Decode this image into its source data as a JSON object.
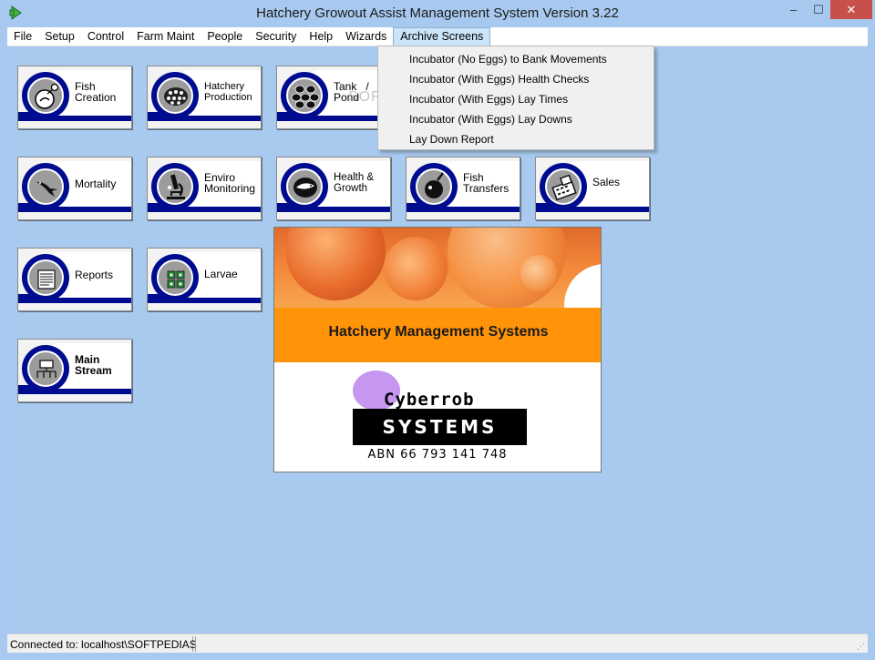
{
  "window": {
    "title": "Hatchery Growout Assist Management System Version 3.22",
    "icon": "green-arrow-icon",
    "controls": {
      "minimize": "–",
      "maximize": "☐",
      "close": "✕"
    }
  },
  "menubar": {
    "items": [
      "File",
      "Setup",
      "Control",
      "Farm Maint",
      "People",
      "Security",
      "Help",
      "Wizards",
      "Archive Screens"
    ],
    "open_item": "Archive Screens"
  },
  "archive_menu": {
    "items": [
      "Incubator (No Eggs) to Bank Movements",
      "Incubator (With Eggs) Health Checks",
      "Incubator (With Eggs) Lay Times",
      "Incubator (With Eggs) Lay Downs",
      "Lay Down Report"
    ]
  },
  "tiles": [
    {
      "line1": "Fish",
      "line2": "Creation",
      "icon": "fish-egg-icon"
    },
    {
      "line1": "Hatchery",
      "line2": "Production",
      "icon": "egg-basket-icon"
    },
    {
      "line1": "Tank",
      "line2": "Pond",
      "icon": "tanks-icon",
      "extra": "/"
    },
    {
      "line1": "Mortality",
      "line2": "",
      "icon": "dead-fish-icon"
    },
    {
      "line1": "Enviro",
      "line2": "Monitoring",
      "icon": "microscope-icon"
    },
    {
      "line1": "Health &",
      "line2": "Growth",
      "icon": "fish-icon"
    },
    {
      "line1": "Fish",
      "line2": "Transfers",
      "icon": "net-fish-icon"
    },
    {
      "line1": "Sales",
      "line2": "",
      "icon": "cash-register-icon"
    },
    {
      "line1": "Reports",
      "line2": "",
      "icon": "report-icon"
    },
    {
      "line1": "Larvae",
      "line2": "",
      "icon": "larvae-icon"
    },
    {
      "line1": "Main",
      "line2": "Stream",
      "icon": "flowchart-icon"
    }
  ],
  "splash": {
    "caption": "Hatchery Management Systems",
    "company": "Cyberrob",
    "systems": "SYSTEMS",
    "abn": "ABN 66 793 141 748"
  },
  "watermark": "SOFTPEDIA",
  "status": {
    "connection": "Connected to: localhost\\SOFTPEDIAS"
  },
  "colors": {
    "background": "#a8caee",
    "tile_band": "#000c8f",
    "splash_orange": "#ff9408",
    "close_button": "#c7504a"
  }
}
